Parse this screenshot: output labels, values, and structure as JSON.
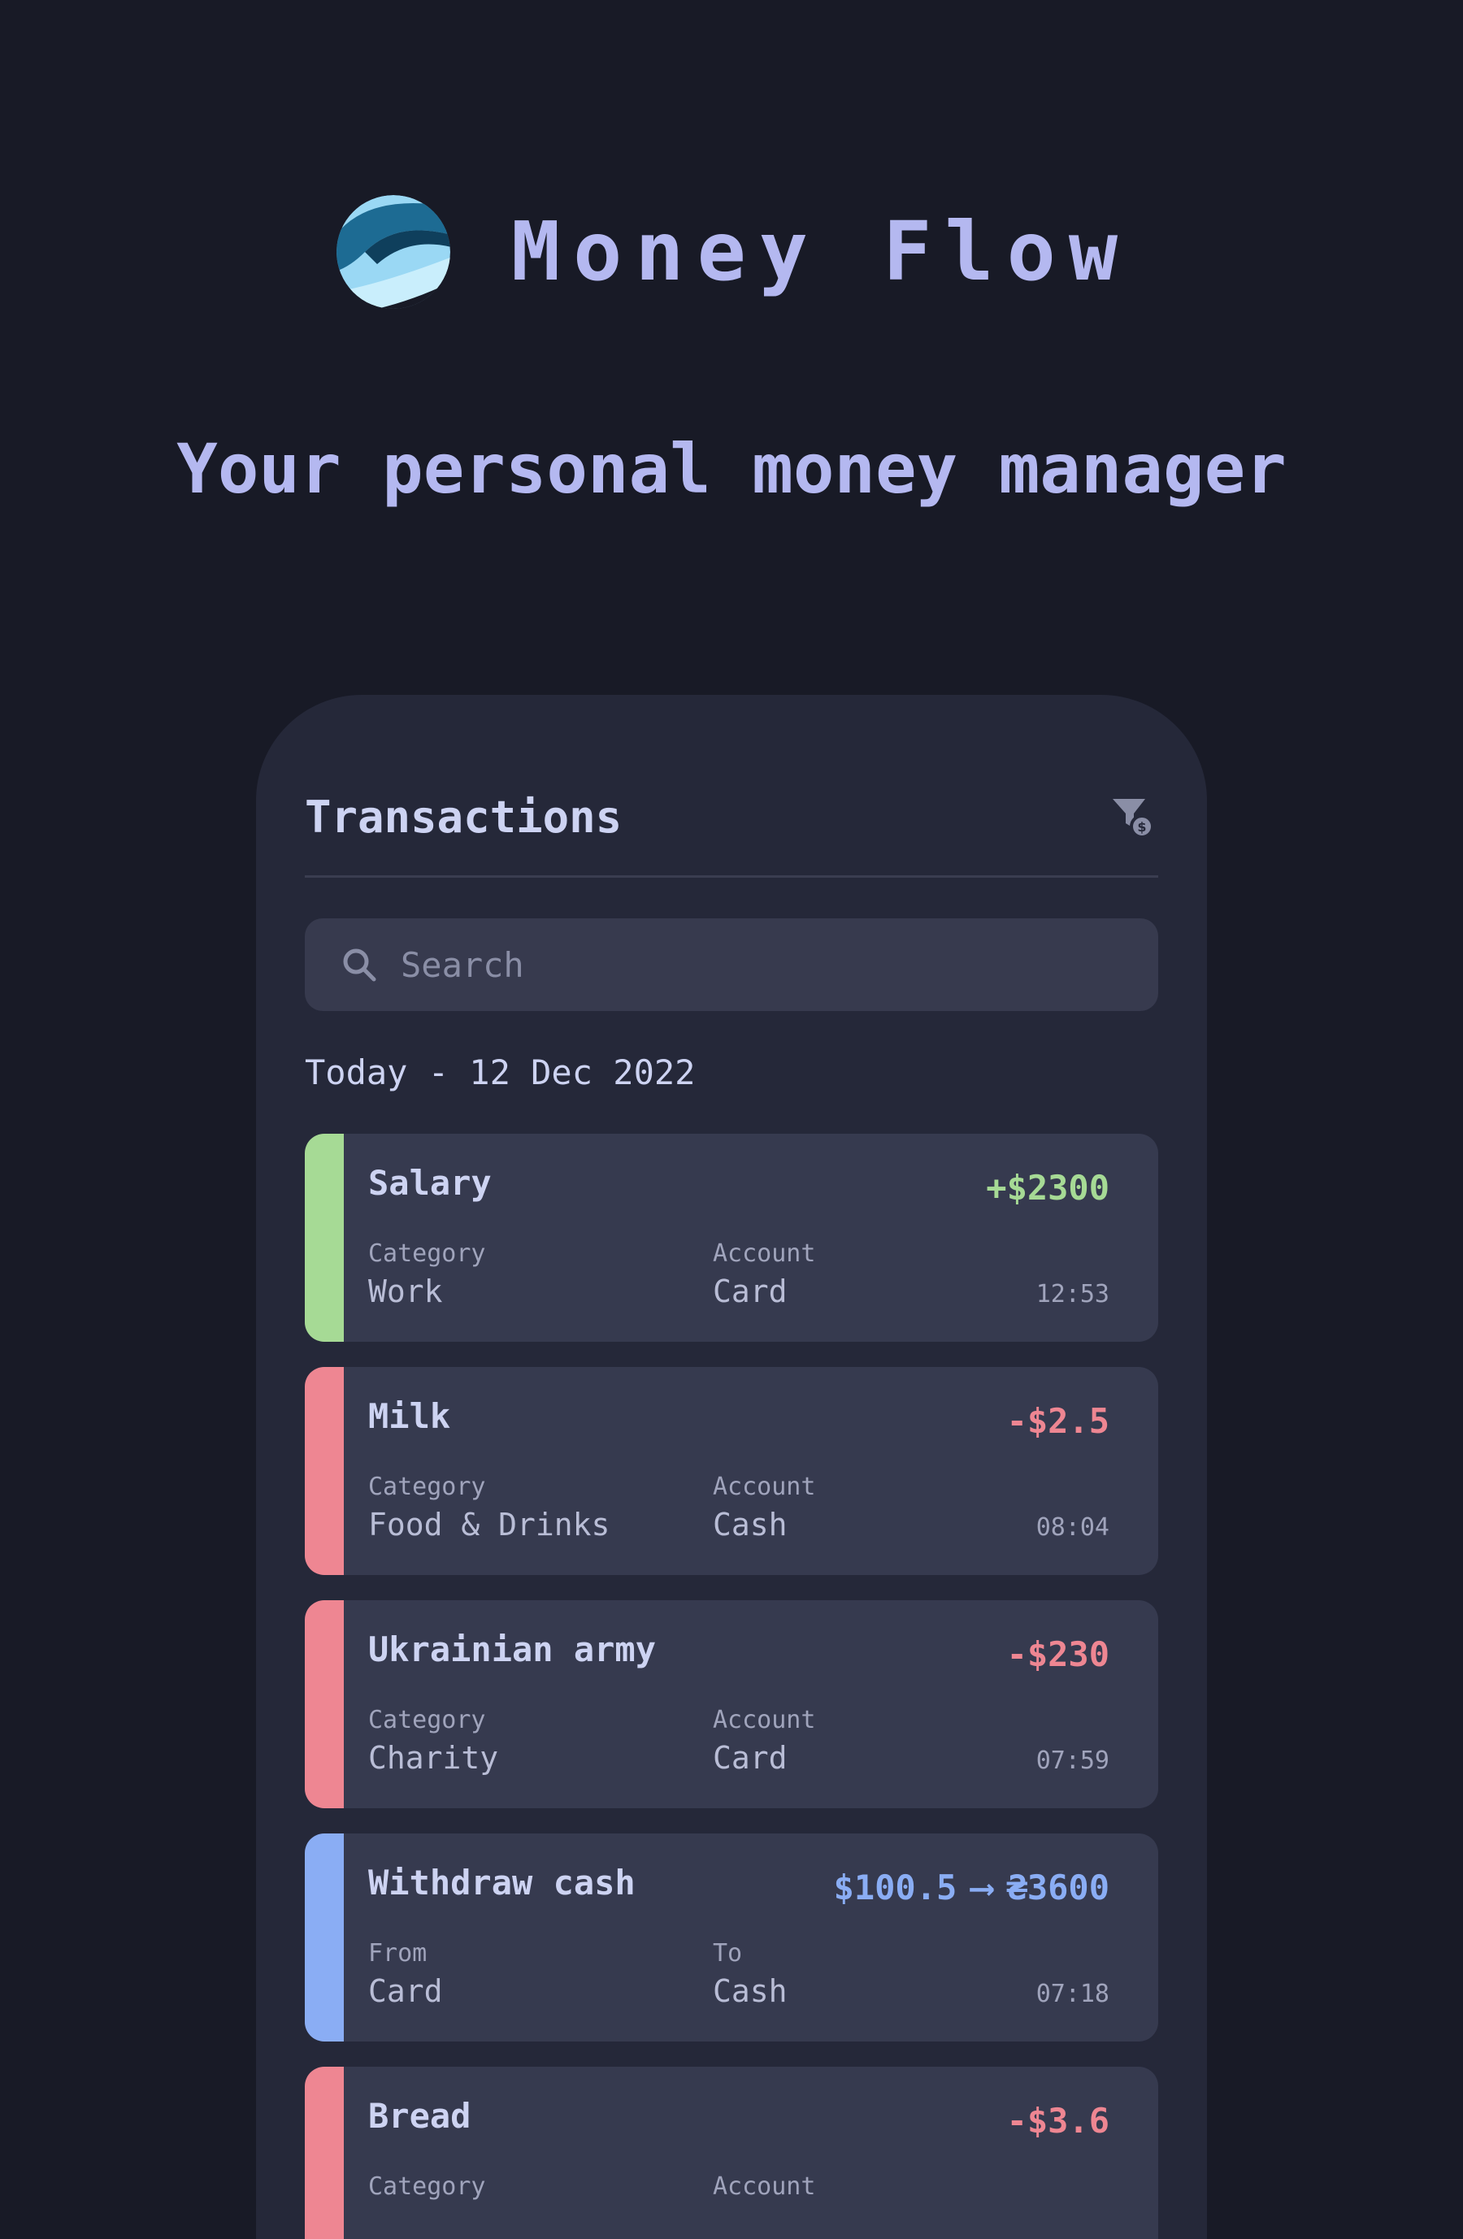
{
  "brand": {
    "app_name": "Money Flow",
    "tagline": "Your personal money manager"
  },
  "colors": {
    "background": "#181a26",
    "card": "#252839",
    "income": "#a6da95",
    "expense": "#ee8692",
    "transfer": "#8aadf4",
    "title": "#b4b8f0"
  },
  "screen": {
    "title": "Transactions",
    "filter_icon": "filter-dollar-icon",
    "search": {
      "placeholder": "Search",
      "value": ""
    },
    "date_header": "Today - 12 Dec 2022",
    "transactions": [
      {
        "type": "income",
        "name": "Salary",
        "amount": "+$2300",
        "label1": "Category",
        "value1": "Work",
        "label2": "Account",
        "value2": "Card",
        "time": "12:53"
      },
      {
        "type": "expense",
        "name": "Milk",
        "amount": "-$2.5",
        "label1": "Category",
        "value1": "Food & Drinks",
        "label2": "Account",
        "value2": "Cash",
        "time": "08:04"
      },
      {
        "type": "expense",
        "name": "Ukrainian army",
        "amount": "-$230",
        "label1": "Category",
        "value1": "Charity",
        "label2": "Account",
        "value2": "Card",
        "time": "07:59"
      },
      {
        "type": "transfer",
        "name": "Withdraw cash",
        "amount_from": "$100.5",
        "amount_arrow": "⟶",
        "amount_to": "₴3600",
        "label1": "From",
        "value1": "Card",
        "label2": "To",
        "value2": "Cash",
        "time": "07:18"
      },
      {
        "type": "expense",
        "name": "Bread",
        "amount": "-$3.6",
        "label1": "Category",
        "value1": "",
        "label2": "Account",
        "value2": "",
        "time": ""
      }
    ]
  }
}
